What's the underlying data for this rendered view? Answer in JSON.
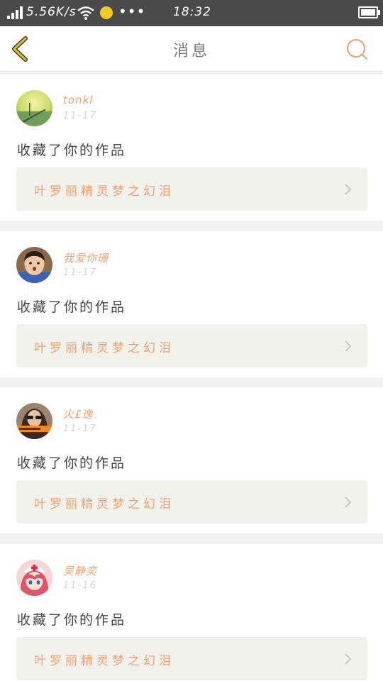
{
  "status_bar": {
    "speed": "5.56K/s",
    "time": "18:32",
    "icons": [
      "signal-icon",
      "wifi-icon",
      "notification-dot-icon",
      "more-dots-icon",
      "battery-icon"
    ],
    "more": "•••"
  },
  "nav": {
    "title": "消息",
    "back_icon": "chevron-left-icon",
    "search_icon": "search-icon",
    "accent_color": "#f0a070",
    "back_color": "#d8a400"
  },
  "messages": [
    {
      "username": "tonkl",
      "date": "11-17",
      "action": "收藏了你的作品",
      "work_title": "叶罗丽精灵梦之幻泪",
      "avatar": "pier-landscape-avatar"
    },
    {
      "username": "我爱你珊",
      "date": "11-17",
      "action": "收藏了你的作品",
      "work_title": "叶罗丽精灵梦之幻泪",
      "avatar": "child-face-avatar"
    },
    {
      "username": "火£逸",
      "date": "11-17",
      "action": "收藏了你的作品",
      "work_title": "叶罗丽精灵梦之幻泪",
      "avatar": "girl-sunglasses-avatar"
    },
    {
      "username": "吴静奕",
      "date": "11-16",
      "action": "收藏了你的作品",
      "work_title": "叶罗丽精灵梦之幻泪",
      "avatar": "anime-nurse-avatar"
    }
  ]
}
